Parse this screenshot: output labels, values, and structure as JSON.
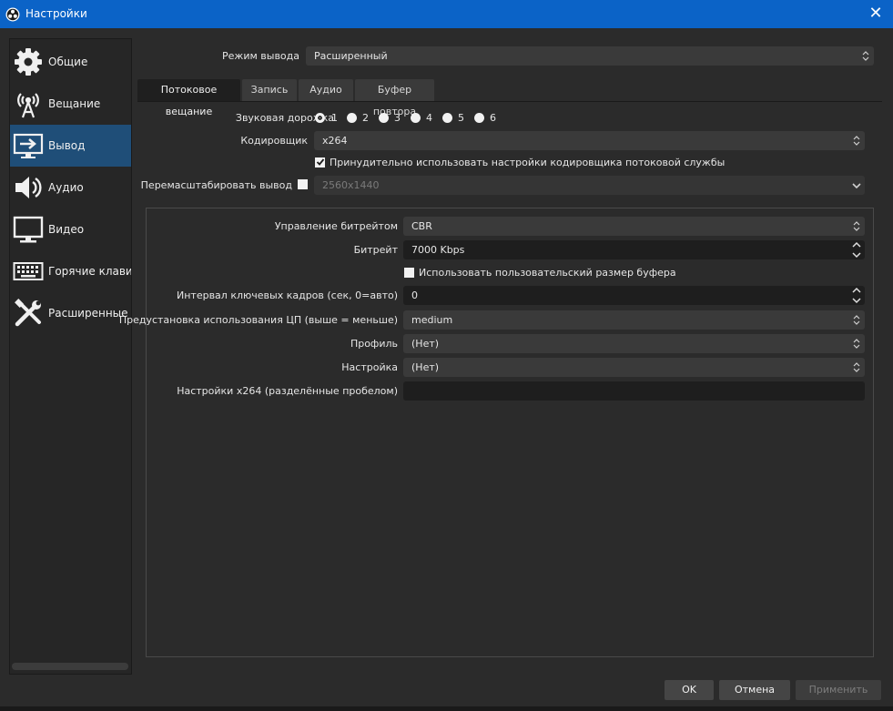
{
  "window": {
    "title": "Настройки"
  },
  "sidebar": {
    "items": [
      {
        "label": "Общие",
        "icon": "gear-icon"
      },
      {
        "label": "Вещание",
        "icon": "broadcast-icon"
      },
      {
        "label": "Вывод",
        "icon": "output-icon",
        "active": true
      },
      {
        "label": "Аудио",
        "icon": "speaker-icon"
      },
      {
        "label": "Видео",
        "icon": "monitor-icon"
      },
      {
        "label": "Горячие клавиш",
        "icon": "keyboard-icon"
      },
      {
        "label": "Расширенные",
        "icon": "tools-icon"
      }
    ]
  },
  "output_mode": {
    "label": "Режим вывода",
    "value": "Расширенный"
  },
  "tabs": [
    "Потоковое вещание",
    "Запись",
    "Аудио",
    "Буфер повтора"
  ],
  "streaming": {
    "audio_track": {
      "label": "Звуковая дорожка",
      "options": [
        "1",
        "2",
        "3",
        "4",
        "5",
        "6"
      ],
      "selected": "1"
    },
    "encoder": {
      "label": "Кодировщик",
      "value": "x264"
    },
    "enforce": {
      "label": "Принудительно использовать настройки кодировщика потоковой службы",
      "checked": true
    },
    "rescale": {
      "label": "Перемасштабировать вывод",
      "checked": false,
      "value": "2560x1440"
    }
  },
  "encoder_settings": {
    "rate_control": {
      "label": "Управление битрейтом",
      "value": "CBR"
    },
    "bitrate": {
      "label": "Битрейт",
      "value": "7000 Kbps"
    },
    "custom_buffer": {
      "label": "Использовать пользовательский размер буфера",
      "checked": false
    },
    "keyframe": {
      "label": "Интервал ключевых кадров (сек, 0=авто)",
      "value": "0"
    },
    "preset": {
      "label": "Предустановка использования ЦП (выше = меньше)",
      "value": "medium"
    },
    "profile": {
      "label": "Профиль",
      "value": "(Нет)"
    },
    "tune": {
      "label": "Настройка",
      "value": "(Нет)"
    },
    "x264opts": {
      "label": "Настройки x264 (разделённые пробелом)",
      "value": ""
    }
  },
  "buttons": {
    "ok": "OK",
    "cancel": "Отмена",
    "apply": "Применить"
  },
  "colors": {
    "titlebar": "#0b63c7",
    "active_sidebar": "#1f4e78",
    "background": "#2b2b2b"
  }
}
